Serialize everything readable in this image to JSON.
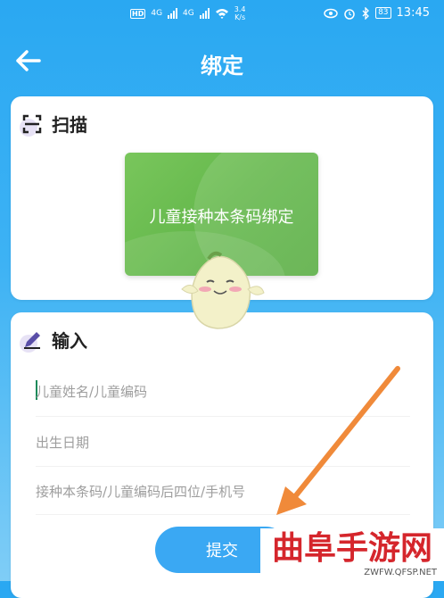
{
  "status_bar": {
    "hd_label": "HD",
    "signal_1_label": "4G",
    "signal_2_label": "4G",
    "speed_value": "3.4",
    "speed_unit": "K/s",
    "battery": "83",
    "time": "13:45"
  },
  "header": {
    "title": "绑定",
    "back_icon": "back-arrow-icon"
  },
  "scan_section": {
    "title": "扫描",
    "icon": "scan-icon",
    "banner_label": "儿童接种本条码绑定"
  },
  "input_section": {
    "title": "输入",
    "icon": "pencil-icon",
    "fields": {
      "child_name_placeholder": "儿童姓名/儿童编码",
      "birth_date_placeholder": "出生日期",
      "code_placeholder": "接种本条码/儿童编码后四位/手机号"
    }
  },
  "submit_label": "提交",
  "watermark": {
    "title": "曲阜手游网",
    "url": "ZWFW.QFSP.NET"
  },
  "colors": {
    "primary": "#2aa8f2",
    "button": "#3aa8f3",
    "banner": "#6bbd52",
    "arrow": "#f08a3a",
    "watermark": "#d5262c"
  }
}
